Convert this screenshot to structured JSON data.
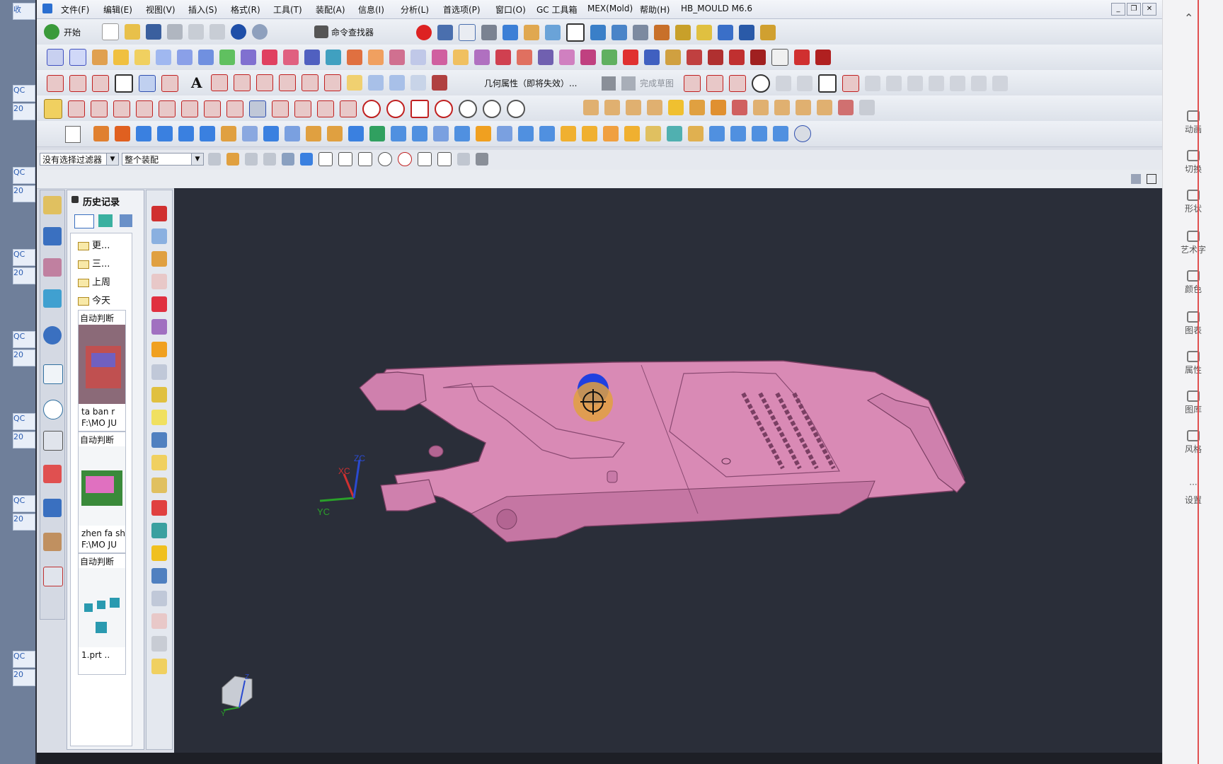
{
  "menu": {
    "items": [
      "文件(F)",
      "编辑(E)",
      "视图(V)",
      "插入(S)",
      "格式(R)",
      "工具(T)",
      "装配(A)",
      "信息(I)",
      "分析(L)",
      "首选项(P)",
      "窗口(O)",
      "GC 工具箱",
      "MEX(Mold)",
      "帮助(H)",
      "HB_MOULD M6.6"
    ]
  },
  "toolbar": {
    "start_label": "开始",
    "command_finder_label": "命令查找器",
    "geometry_props_label": "几何属性（即将失效）...",
    "finish_sketch_label": "完成草图"
  },
  "filterbar": {
    "selection_filter": "没有选择过滤器",
    "assembly_scope": "整个装配"
  },
  "history": {
    "title": "历史记录",
    "folders": [
      "更...",
      "三...",
      "上周",
      "今天"
    ],
    "cards": [
      {
        "tag": "自动判断",
        "name": "ta ban r",
        "path": "F:\\MO JU"
      },
      {
        "tag": "自动判断",
        "name": "zhen fa sh",
        "path": "F:\\MO JU"
      },
      {
        "tag": "自动判断",
        "name": "1.prt ..",
        "path": ""
      }
    ]
  },
  "viewport": {
    "axes": {
      "x": "XC",
      "y": "YC",
      "z": "ZC"
    },
    "mini_axes": {
      "y": "Y",
      "z": "Z"
    },
    "part_color": "#d98ab5"
  },
  "right_panel": {
    "items": [
      "动画",
      "切换",
      "形状",
      "艺术字",
      "颜色",
      "图表",
      "属性",
      "图库",
      "风格",
      "设置"
    ]
  },
  "left_strip": {
    "labels": [
      "收",
      "QC",
      "20",
      "QC",
      "20",
      "QC",
      "20",
      "QC",
      "20",
      "QC",
      "20",
      "QC",
      "20",
      "QC",
      "20"
    ]
  },
  "colors": {
    "viewport_bg": "#2a2e39",
    "part_fill": "#d98ab5",
    "part_edge": "#7a3f63",
    "cursor_highlight": "#e0a040"
  }
}
